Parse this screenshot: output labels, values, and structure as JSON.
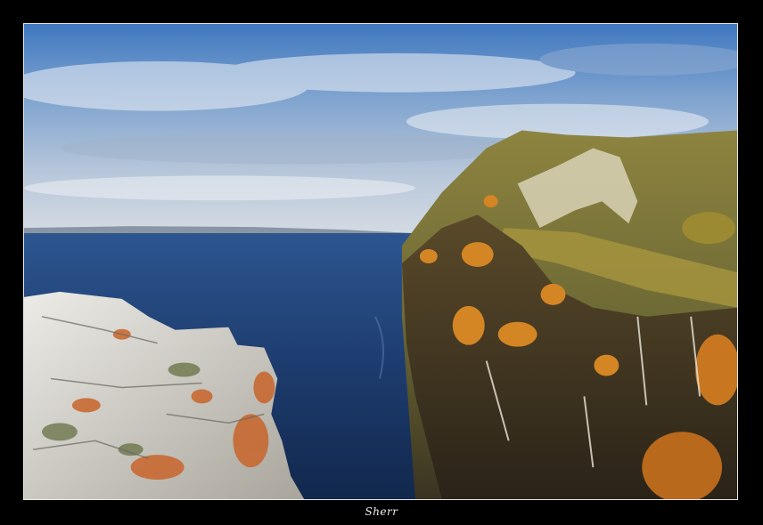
{
  "photo": {
    "signature": "Sherr",
    "colors": {
      "sky_top": "#4f86c9",
      "sky_bottom": "#c9d4e0",
      "water": "#1f3f70",
      "cliff_grass": "#9a8d3c",
      "autumn_foliage": "#d7892a",
      "rock": "#d8d6cf",
      "lichen": "#c96a2a"
    }
  }
}
